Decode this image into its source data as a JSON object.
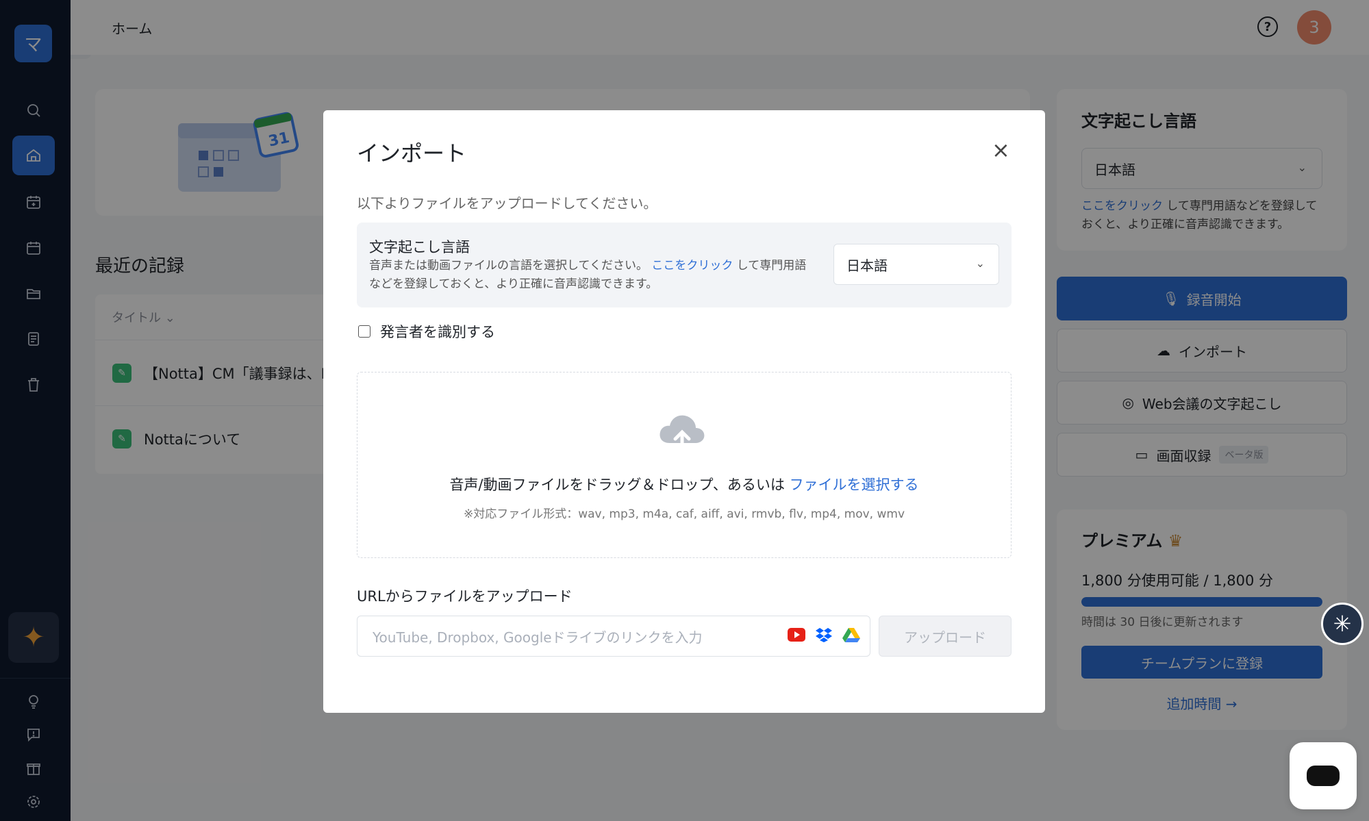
{
  "topbar": {
    "title": "ホーム",
    "avatar_text": "3",
    "help_label": "?"
  },
  "logo_glyph": "マ",
  "sidebar": {
    "items": [
      {
        "icon": "search-icon"
      },
      {
        "icon": "home-icon",
        "active": true
      },
      {
        "icon": "calendar-plus-icon"
      },
      {
        "icon": "calendar-icon"
      },
      {
        "icon": "folder-icon"
      },
      {
        "icon": "notes-icon"
      },
      {
        "icon": "trash-icon"
      }
    ],
    "bottom_items": [
      {
        "icon": "lightbulb-icon"
      },
      {
        "icon": "feedback-icon"
      },
      {
        "icon": "gift-icon"
      },
      {
        "icon": "settings-icon"
      }
    ]
  },
  "main": {
    "recent_title": "最近の記録",
    "column_title": "タイトル",
    "rows": [
      {
        "title": "【Notta】CM「議事録は、N"
      },
      {
        "title": "Nottaについて"
      }
    ],
    "calendar_day": "31"
  },
  "right_panel": {
    "lang_title": "文字起こし言語",
    "lang_value": "日本語",
    "hint_link": "ここをクリック",
    "hint_text": " して専門用語などを登録しておくと、より正確に音声認識できます。",
    "record_btn": "録音開始",
    "import_btn": "インポート",
    "web_meeting_btn": "Web会議の文字起こし",
    "screen_record_btn": "画面収録",
    "beta_label": "ベータ版",
    "premium_title": "プレミアム",
    "usage": "1,800 分使用可能 / 1,800 分",
    "usage_fraction": 1.0,
    "renew_text": "時間は 30 日後に更新されます",
    "team_btn": "チームプランに登録",
    "add_time": "追加時間 →"
  },
  "modal": {
    "title": "インポート",
    "close_label": "×",
    "subtitle": "以下よりファイルをアップロードしてください。",
    "lang_title": "文字起こし言語",
    "lang_desc_pre": "音声または動画ファイルの言語を選択してください。",
    "lang_desc_link": "ここをクリック",
    "lang_desc_post": " して専門用語などを登録しておくと、より正確に音声認識できます。",
    "lang_value": "日本語",
    "speaker_label": "発言者を識別する",
    "drop_text": "音声/動画ファイルをドラッグ＆ドロップ、あるいは ",
    "drop_link": "ファイルを選択する",
    "formats": "※対応ファイル形式：wav, mp3, m4a, caf, aiff, avi, rmvb, flv, mp4, mov, wmv",
    "url_title": "URLからファイルをアップロード",
    "url_placeholder": "YouTube, Dropbox, Googleドライブのリンクを入力",
    "upload_btn": "アップロード"
  },
  "colors": {
    "accent": "#2f6fd6",
    "sidebar": "#0f1a2e",
    "avatar": "#f08a6c"
  }
}
